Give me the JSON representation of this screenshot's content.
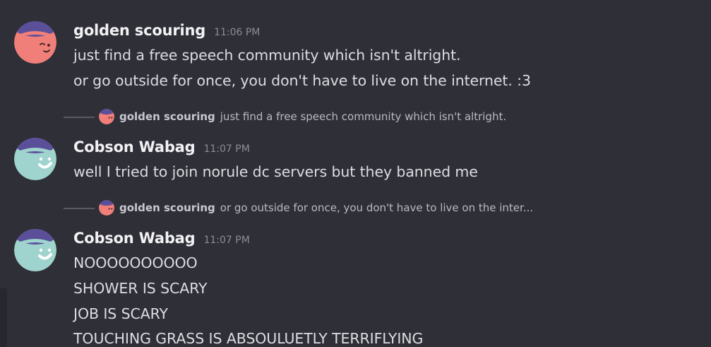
{
  "messages": [
    {
      "author": "golden scouring",
      "time": "11:06 PM",
      "lines": [
        "just find a free speech community which isn't altright.",
        "or go outside for once, you don't have to live on the internet. :3"
      ]
    },
    {
      "reply": {
        "author": "golden scouring",
        "text": "just find a free speech community which isn't altright."
      },
      "author": "Cobson Wabag",
      "time": "11:07 PM",
      "lines": [
        "well I tried to join norule dc servers but they banned me"
      ]
    },
    {
      "reply": {
        "author": "golden scouring",
        "text": "or go outside for once, you don't have to live on the inter..."
      },
      "author": "Cobson Wabag",
      "time": "11:07 PM",
      "lines": [
        "NOOOOOOOOOO",
        "SHOWER IS SCARY",
        "JOB IS SCARY",
        "TOUCHING GRASS IS ABSOULUETLY TERRIFLYING"
      ]
    }
  ],
  "colors": {
    "background": "#2f2f37",
    "golden_avatar": "#f07f7a",
    "cobson_avatar": "#9fd3cd",
    "avatar_hat": "#5b4f9a"
  },
  "icons": {
    "golden_avatar": "winking-face-avatar-icon",
    "cobson_avatar": "smiling-face-avatar-icon"
  }
}
